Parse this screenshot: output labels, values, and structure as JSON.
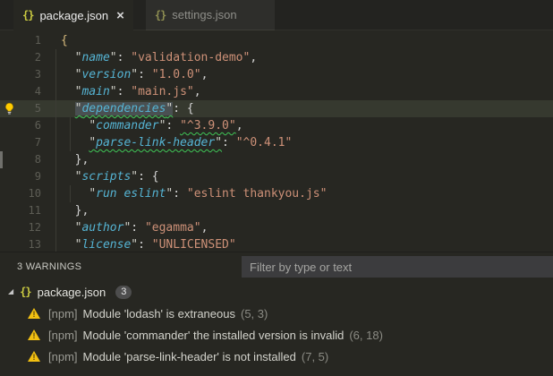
{
  "tabs": [
    {
      "label": "package.json",
      "icon": "{}",
      "close": "×",
      "active": true
    },
    {
      "label": "settings.json",
      "icon": "{}",
      "active": false
    }
  ],
  "editor": {
    "lines": [
      {
        "n": 1,
        "indent": 0,
        "tokens": [
          [
            "b0",
            "{"
          ]
        ]
      },
      {
        "n": 2,
        "indent": 2,
        "tokens": [
          [
            "q",
            "\""
          ],
          [
            "k",
            "name"
          ],
          [
            "q",
            "\""
          ],
          [
            "p",
            ": "
          ],
          [
            "s",
            "\"validation-demo\""
          ],
          [
            "p",
            ","
          ]
        ]
      },
      {
        "n": 3,
        "indent": 2,
        "tokens": [
          [
            "q",
            "\""
          ],
          [
            "k",
            "version"
          ],
          [
            "q",
            "\""
          ],
          [
            "p",
            ": "
          ],
          [
            "s",
            "\"1.0.0\""
          ],
          [
            "p",
            ","
          ]
        ]
      },
      {
        "n": 4,
        "indent": 2,
        "tokens": [
          [
            "q",
            "\""
          ],
          [
            "k",
            "main"
          ],
          [
            "q",
            "\""
          ],
          [
            "p",
            ": "
          ],
          [
            "s",
            "\"main.js\""
          ],
          [
            "p",
            ","
          ]
        ]
      },
      {
        "n": 5,
        "indent": 2,
        "current": true,
        "lightbulb": true,
        "tokens": [
          [
            "q hl sq",
            "\""
          ],
          [
            "k hl sq",
            "dependencies"
          ],
          [
            "q hl sq",
            "\""
          ],
          [
            "p",
            ": "
          ],
          [
            "p",
            "{"
          ]
        ]
      },
      {
        "n": 6,
        "indent": 4,
        "tokens": [
          [
            "q",
            "\""
          ],
          [
            "k",
            "commander"
          ],
          [
            "q",
            "\""
          ],
          [
            "p",
            ": "
          ],
          [
            "s sq",
            "\"^3.9.0\""
          ],
          [
            "p",
            ","
          ]
        ]
      },
      {
        "n": 7,
        "indent": 4,
        "tokens": [
          [
            "q sq",
            "\""
          ],
          [
            "k sq",
            "parse-link-header"
          ],
          [
            "q sq",
            "\""
          ],
          [
            "p",
            ": "
          ],
          [
            "s",
            "\"^0.4.1\""
          ]
        ]
      },
      {
        "n": 8,
        "indent": 2,
        "tokens": [
          [
            "p",
            "},"
          ]
        ]
      },
      {
        "n": 9,
        "indent": 2,
        "tokens": [
          [
            "q",
            "\""
          ],
          [
            "k",
            "scripts"
          ],
          [
            "q",
            "\""
          ],
          [
            "p",
            ": "
          ],
          [
            "p",
            "{"
          ]
        ]
      },
      {
        "n": 10,
        "indent": 4,
        "tokens": [
          [
            "q",
            "\""
          ],
          [
            "k",
            "run eslint"
          ],
          [
            "q",
            "\""
          ],
          [
            "p",
            ": "
          ],
          [
            "s",
            "\"eslint thankyou.js\""
          ]
        ]
      },
      {
        "n": 11,
        "indent": 2,
        "tokens": [
          [
            "p",
            "},"
          ]
        ]
      },
      {
        "n": 12,
        "indent": 2,
        "tokens": [
          [
            "q",
            "\""
          ],
          [
            "k",
            "author"
          ],
          [
            "q",
            "\""
          ],
          [
            "p",
            ": "
          ],
          [
            "s",
            "\"egamma\""
          ],
          [
            "p",
            ","
          ]
        ]
      },
      {
        "n": 13,
        "indent": 2,
        "tokens": [
          [
            "q",
            "\""
          ],
          [
            "k",
            "license"
          ],
          [
            "q",
            "\""
          ],
          [
            "p",
            ": "
          ],
          [
            "s",
            "\"UNLICENSED\""
          ]
        ]
      }
    ]
  },
  "panel": {
    "header": {
      "count_label": "3 WARNINGS",
      "filter_placeholder": "Filter by type or text"
    },
    "tree": {
      "file": {
        "icon": "{}",
        "name": "package.json",
        "badge": "3",
        "twistie": "◢"
      },
      "warnings": [
        {
          "source": "[npm]",
          "message": "Module 'lodash' is extraneous",
          "position": "(5, 3)"
        },
        {
          "source": "[npm]",
          "message": "Module 'commander' the installed version is invalid",
          "position": "(6, 18)"
        },
        {
          "source": "[npm]",
          "message": "Module 'parse-link-header' is not installed",
          "position": "(7, 5)"
        }
      ]
    }
  },
  "colors": {
    "editor_bg": "#272722",
    "tab_strip_bg": "#232320",
    "inactive_tab_bg": "#2e2e2b",
    "key": "#55b4d4",
    "string": "#ce9178",
    "bracket_root": "#d7ba7d",
    "squiggle": "#3fc757",
    "current_line": "#36392f",
    "warning_yellow": "#f2c012",
    "json_icon_yellow": "#cbcb41",
    "badge_bg": "#4d4d4d",
    "filter_bg": "#3c3c3e"
  }
}
